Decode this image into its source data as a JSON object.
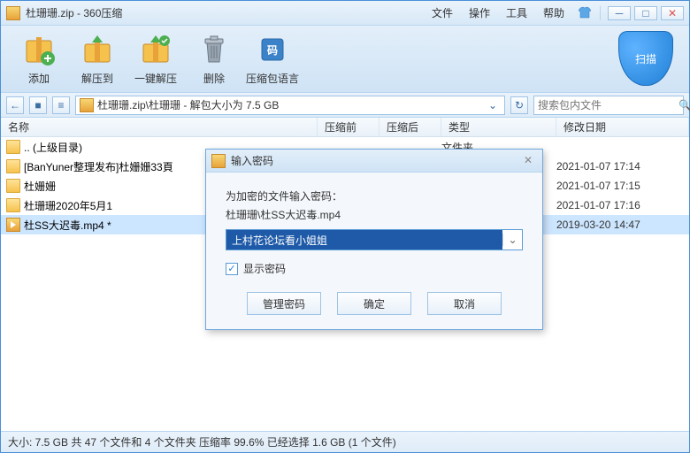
{
  "titlebar": {
    "archive_name": "杜珊珊.zip",
    "app_name": "360压缩"
  },
  "menu": {
    "file": "文件",
    "operate": "操作",
    "tool": "工具",
    "help": "帮助"
  },
  "toolbar": {
    "add": "添加",
    "extract_to": "解压到",
    "one_click": "一键解压",
    "delete": "删除",
    "language": "压缩包语言",
    "scan": "扫描"
  },
  "pathbar": {
    "path": "杜珊珊.zip\\杜珊珊 - 解包大小为 7.5 GB",
    "search_placeholder": "搜索包内文件"
  },
  "columns": {
    "name": "名称",
    "pre": "压缩前",
    "post": "压缩后",
    "type": "类型",
    "date": "修改日期"
  },
  "files": [
    {
      "icon": "up",
      "name": ".. (上级目录)",
      "type": "文件夹",
      "date": ""
    },
    {
      "icon": "folder",
      "name": "[BanYuner整理发布]杜姗姗33頁",
      "type": "",
      "date": "2021-01-07 17:14"
    },
    {
      "icon": "folder",
      "name": "杜姗姗",
      "type": "",
      "date": "2021-01-07 17:15"
    },
    {
      "icon": "folder",
      "name": "杜珊珊2020年5月1",
      "type": "",
      "date": "2021-01-07 17:16"
    },
    {
      "icon": "video",
      "name": "杜SS大迟毒.mp4 *",
      "type": "",
      "date": "2019-03-20 14:47",
      "selected": true
    }
  ],
  "statusbar": {
    "text": "大小: 7.5 GB 共 47 个文件和 4 个文件夹 压缩率 99.6% 已经选择 1.6 GB (1 个文件)"
  },
  "dialog": {
    "title": "输入密码",
    "prompt": "为加密的文件输入密码：",
    "filename": "杜珊珊\\杜SS大迟毒.mp4",
    "password_value": "上村花论坛看小姐姐",
    "show_password": "显示密码",
    "manage": "管理密码",
    "ok": "确定",
    "cancel": "取消"
  }
}
